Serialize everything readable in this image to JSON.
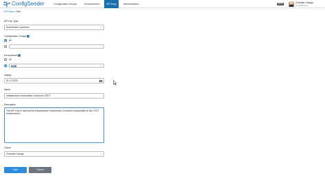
{
  "app": {
    "brand": "ConfigSeeder",
    "logo_icon": "configseeder-logo-icon"
  },
  "nav": {
    "items": [
      {
        "label": "Configuration Groups",
        "active": false
      },
      {
        "label": "Environments",
        "active": false
      },
      {
        "label": "API Keys",
        "active": true
      },
      {
        "label": "Administration",
        "active": false
      }
    ]
  },
  "user": {
    "env_badge": "DEMO",
    "name": "Christian Cavegn",
    "org": "ConfigSeeder"
  },
  "breadcrumb": {
    "parent": "API Keys",
    "separator": ">",
    "current": "Add"
  },
  "form": {
    "api_key_type": {
      "label": "API Key Type",
      "value": "Kubernetes Connector"
    },
    "configuration_groups": {
      "label": "Configuration Groups",
      "options": [
        {
          "label": "All",
          "checked": true
        },
        {
          "label": "",
          "checked": false
        }
      ],
      "select_value": ""
    },
    "environment": {
      "label": "Environment",
      "options": [
        {
          "label": "All",
          "checked": false
        },
        {
          "label": "",
          "checked": true
        }
      ],
      "select_chip": "TEST"
    },
    "validity": {
      "label": "Validity",
      "value": "31.12.2020"
    },
    "name": {
      "label": "Name",
      "value": "Infrastructure Kubernetes Connector TEST"
    },
    "description": {
      "label": "Description",
      "value": "This API Key is used by the Infrastructure Kubernetes Connector responsible for the TEST environment.|"
    },
    "owner": {
      "label": "Owner",
      "value": "Christian Cavegn"
    }
  },
  "actions": {
    "save": "Save",
    "cancel": "Cancel"
  },
  "colors": {
    "accent": "#1a6fae",
    "save_button": "#2f8bdb",
    "cancel_button": "#6c757d",
    "focus_border": "#4a8ec8"
  }
}
